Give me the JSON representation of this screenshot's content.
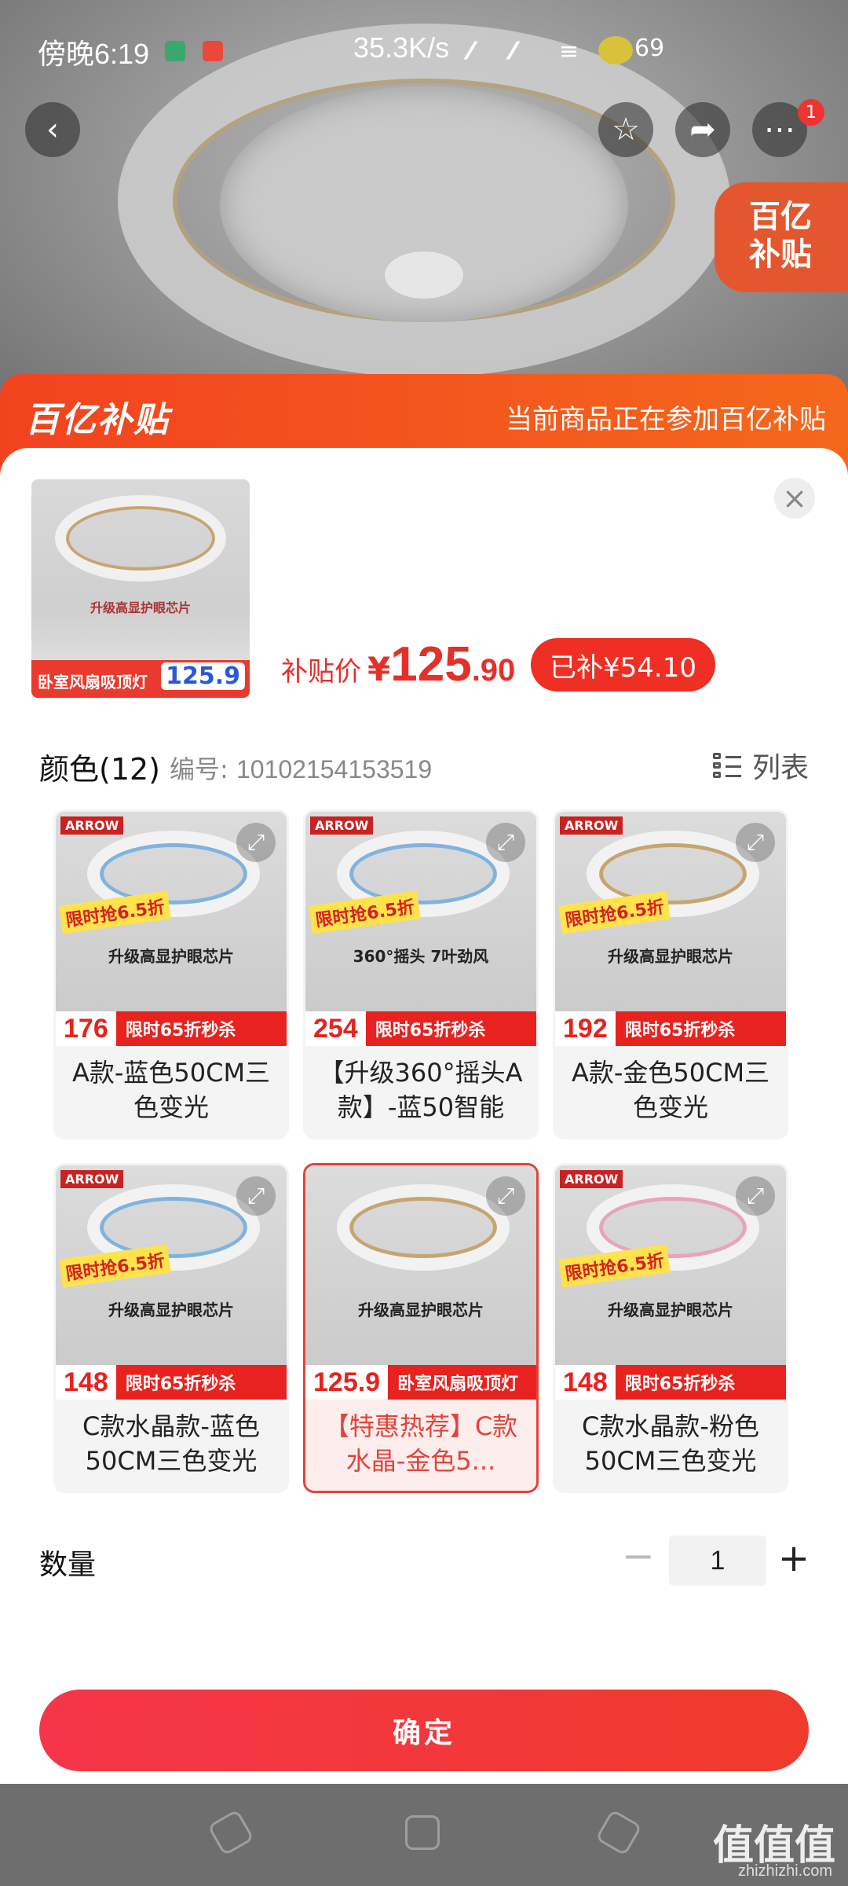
{
  "status_bar": {
    "time": "傍晚6:19",
    "net_speed": "35.3K/s",
    "battery": "69"
  },
  "top_actions": {
    "back_icon": "chevron-left",
    "favorite_icon": "star",
    "share_icon": "share-arrow",
    "more_icon": "ellipsis",
    "more_badge": "1"
  },
  "floating_badge": {
    "line1": "百亿",
    "line2": "补贴"
  },
  "subsidy_banner": {
    "logo": "百亿补贴",
    "message": "当前商品正在参加百亿补贴"
  },
  "product": {
    "thumb_text": "升级高显护眼芯片",
    "thumb_strip": "卧室风扇吸顶灯",
    "thumb_price": "125.9",
    "price_label": "补贴价",
    "price_symbol": "¥",
    "price_int": "125",
    "price_dec": ".90",
    "saved": "已补¥54.10"
  },
  "options": {
    "title": "颜色(12)",
    "sku_label": "编号:",
    "sku_value": "10102154153519",
    "list_label": "列表",
    "items": [
      {
        "name": "A款-蓝色50CM三色变光",
        "price": "176",
        "tag": "限时65折秒杀",
        "promo": "限时抢6.5折",
        "feature": "升级高显护眼芯片",
        "brand": "ARROW",
        "ring": "#7fb3e0"
      },
      {
        "name": "【升级360°摇头A款】-蓝50智能",
        "price": "254",
        "tag": "限时65折秒杀",
        "promo": "限时抢6.5折",
        "feature": "360°摇头 7叶劲风",
        "brand": "ARROW",
        "ring": "#7fb3e0"
      },
      {
        "name": "A款-金色50CM三色变光",
        "price": "192",
        "tag": "限时65折秒杀",
        "promo": "限时抢6.5折",
        "feature": "升级高显护眼芯片",
        "brand": "ARROW",
        "ring": "#c7a56f"
      },
      {
        "name": "C款水晶款-蓝色50CM三色变光",
        "price": "148",
        "tag": "限时65折秒杀",
        "promo": "限时抢6.5折",
        "feature": "升级高显护眼芯片",
        "brand": "ARROW",
        "ring": "#7fb3e0"
      },
      {
        "name": "【特惠热荐】C款水晶-金色5...",
        "price": "125.9",
        "tag": "卧室风扇吸顶灯",
        "promo": "",
        "feature": "升级高显护眼芯片",
        "brand": "",
        "ring": "#c7a56f",
        "selected": true
      },
      {
        "name": "C款水晶款-粉色50CM三色变光",
        "price": "148",
        "tag": "限时65折秒杀",
        "promo": "限时抢6.5折",
        "feature": "升级高显护眼芯片",
        "brand": "ARROW",
        "ring": "#e7a5b7"
      }
    ]
  },
  "quantity": {
    "label": "数量",
    "value": "1",
    "minus": "−",
    "plus": "+"
  },
  "confirm_label": "确定",
  "watermark": {
    "main": "值值值",
    "sub": "zhizhizhi.com"
  },
  "colors": {
    "accent": "#e4302b",
    "banner": "#f1431f"
  }
}
